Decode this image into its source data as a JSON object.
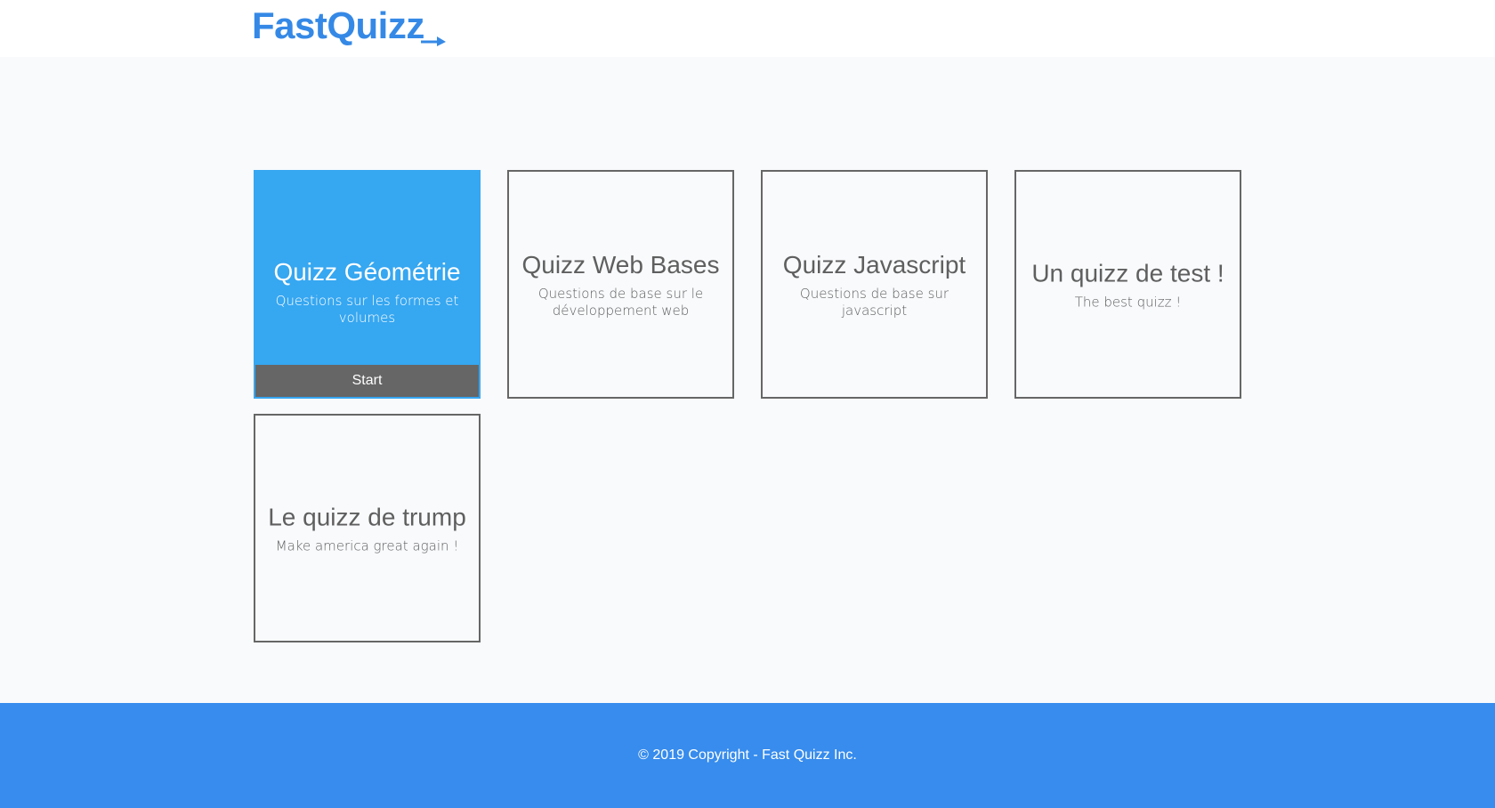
{
  "header": {
    "logo_text": "FastQuizz",
    "logo_color": "#3589e6"
  },
  "quizzes": [
    {
      "title": "Quizz Géométrie",
      "description": "Questions sur les formes et volumes",
      "start_label": "Start",
      "hovered": true
    },
    {
      "title": "Quizz Web Bases",
      "description": "Questions de base sur le développement web"
    },
    {
      "title": "Quizz Javascript",
      "description": "Questions de base sur javascript"
    },
    {
      "title": "Un quizz de test !",
      "description": "The best quizz !"
    },
    {
      "title": "Le quizz de trump",
      "description": "Make america great again !"
    }
  ],
  "footer": {
    "copyright": "© 2019 Copyright - Fast Quizz Inc."
  },
  "colors": {
    "accent": "#36a7f1",
    "footer": "#378ced",
    "card_border": "#666666",
    "text": "#5f5f5f"
  }
}
